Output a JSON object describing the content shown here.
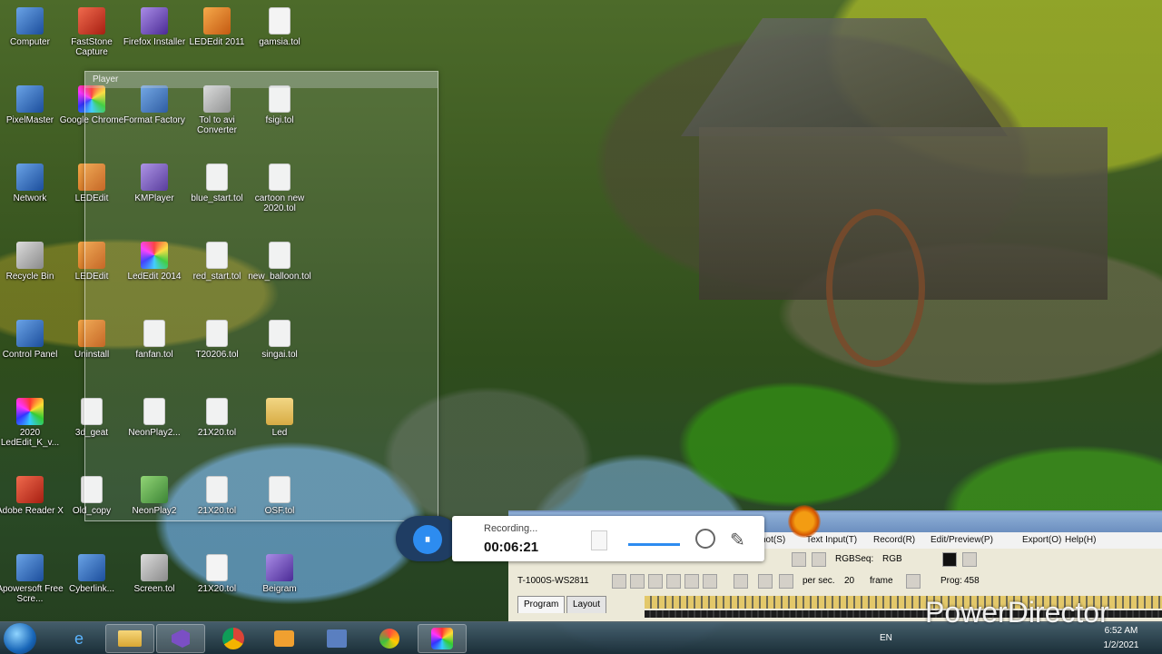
{
  "desktop_icons": [
    {
      "label": "Computer",
      "glyph": "computer-icon"
    },
    {
      "label": "FastStone Capture",
      "glyph": "faststone-icon"
    },
    {
      "label": "Firefox Installer",
      "glyph": "firefox-icon"
    },
    {
      "label": "LEDEdit 2011",
      "glyph": "ledit-icon"
    },
    {
      "label": "gamsia.tol",
      "glyph": "document-icon"
    },
    {
      "label": "PixelMaster",
      "glyph": "pixelmaster-icon"
    },
    {
      "label": "Google Chrome",
      "glyph": "chrome-icon"
    },
    {
      "label": "Format Factory",
      "glyph": "formatfactory-icon"
    },
    {
      "label": "Tol to avi Converter",
      "glyph": "converter-icon"
    },
    {
      "label": "fsigi.tol",
      "glyph": "document-icon"
    },
    {
      "label": "Network",
      "glyph": "network-icon"
    },
    {
      "label": "LEDEdit",
      "glyph": "ledit-icon"
    },
    {
      "label": "KMPlayer",
      "glyph": "kmplayer-icon"
    },
    {
      "label": "blue_start.tol",
      "glyph": "document-icon"
    },
    {
      "label": "cartoon new 2020.tol",
      "glyph": "document-icon"
    },
    {
      "label": "Recycle Bin",
      "glyph": "recycle-bin-icon"
    },
    {
      "label": "LEDEdit",
      "glyph": "ledit-icon"
    },
    {
      "label": "LedEdit 2014",
      "glyph": "ledit-multicolor-icon"
    },
    {
      "label": "red_start.tol",
      "glyph": "document-icon"
    },
    {
      "label": "new_balloon.tol",
      "glyph": "document-icon"
    },
    {
      "label": "Control Panel",
      "glyph": "control-panel-icon"
    },
    {
      "label": "Uninstall",
      "glyph": "uninstall-icon"
    },
    {
      "label": "fanfan.tol",
      "glyph": "document-icon"
    },
    {
      "label": "T20206.tol",
      "glyph": "document-icon"
    },
    {
      "label": "singai.tol",
      "glyph": "document-icon"
    },
    {
      "label": "2020 LedEdit_K_v...",
      "glyph": "ledit-multicolor-icon"
    },
    {
      "label": "3d_geat",
      "glyph": "document-icon"
    },
    {
      "label": "NeonPlay2...",
      "glyph": "document-icon"
    },
    {
      "label": "21X20.tol",
      "glyph": "document-icon"
    },
    {
      "label": "Led",
      "glyph": "folder-icon"
    },
    {
      "label": "Adobe Reader X",
      "glyph": "adobe-reader-icon"
    },
    {
      "label": "Old_copy",
      "glyph": "document-icon"
    },
    {
      "label": "NeonPlay2",
      "glyph": "neonplay-icon"
    },
    {
      "label": "21X20.tol",
      "glyph": "document-icon"
    },
    {
      "label": "OSF.tol",
      "glyph": "document-icon"
    },
    {
      "label": "Apowersoft Free Scre...",
      "glyph": "apowersoft-icon"
    },
    {
      "label": "Cyberlink...",
      "glyph": "cyberlink-icon"
    },
    {
      "label": "Screen.tol",
      "glyph": "screen-icon"
    },
    {
      "label": "21X20.tol",
      "glyph": "document-icon"
    },
    {
      "label": "Beigram",
      "glyph": "beigram-icon"
    }
  ],
  "player_window": {
    "title": "Player"
  },
  "recorder": {
    "status": "Recording...",
    "time": "00:06:21",
    "pause_symbol": "⏸",
    "accent": "#2d8cf0"
  },
  "app_window": {
    "menu": [
      "hot(S)",
      "Text Input(T)",
      "Record(R)",
      "Edit/Preview(P)",
      "Export(O)",
      "Help(H)"
    ],
    "rgb_label": "RGBSeq:",
    "rgb_value": "RGB",
    "model": "T-1000S-WS2811",
    "per_sec_label": "per sec.",
    "per_sec_value": "20",
    "frame_label": "frame",
    "prog_label": "Prog:",
    "prog_value": "458",
    "tabs": [
      "Program",
      "Layout"
    ]
  },
  "taskbar": {
    "items": [
      "ie-icon",
      "explorer-icon",
      "visual-studio-icon",
      "chrome-icon",
      "media-player-icon",
      "network-app-icon",
      "uc-browser-icon",
      "ledit-taskbar-icon"
    ],
    "lang": "EN",
    "clock_time": "6:52 AM",
    "clock_date": "1/2/2021"
  },
  "watermark": "PowerDirector"
}
